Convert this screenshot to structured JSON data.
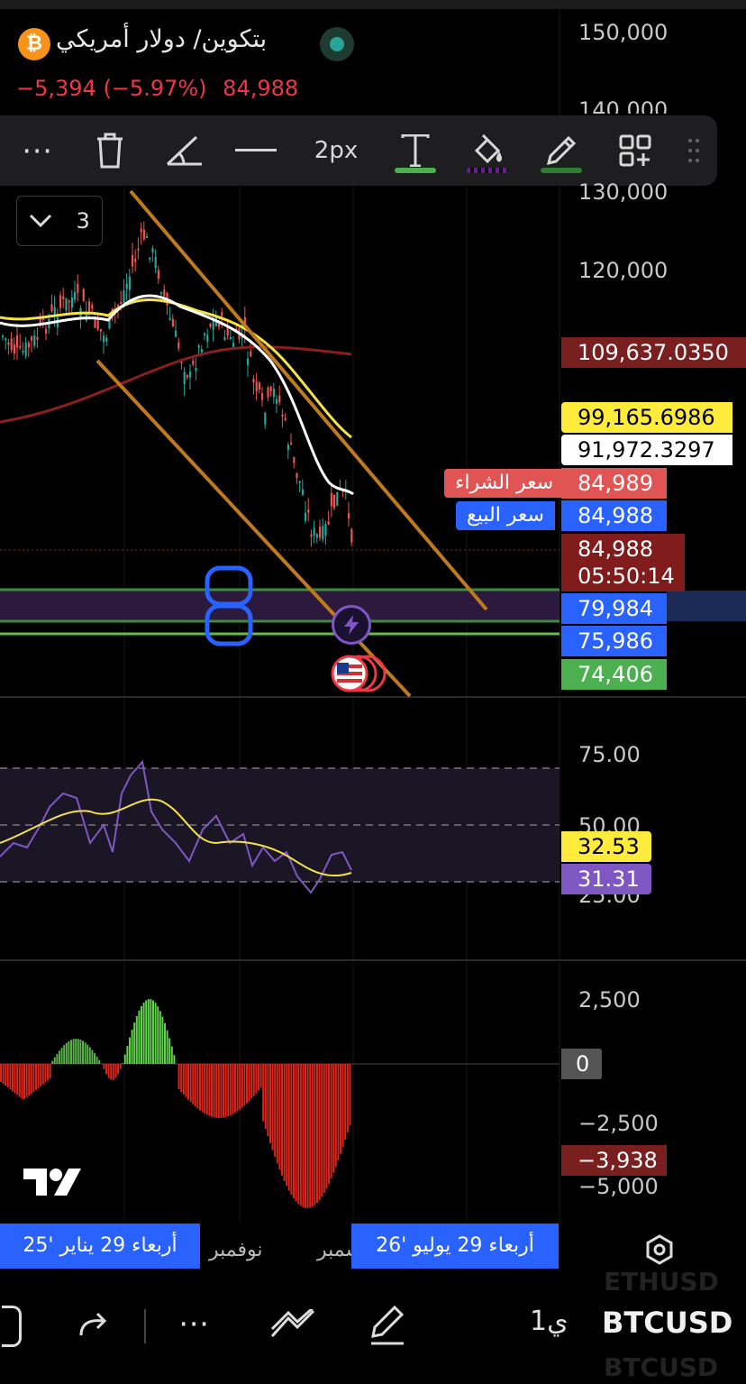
{
  "header": {
    "coin_icon": "bitcoin-icon",
    "symbol_title": "بتكوين/ دولار أمريكي",
    "change": "−5,394 (−5.97%)",
    "last_price": "84,988",
    "market_status": "live-dot"
  },
  "toolbar": {
    "more_label": "⋯",
    "delete_icon": "trash-icon",
    "angle_icon": "angle-icon",
    "line_style_icon": "line-style-icon",
    "width_label": "2px",
    "text_icon": "text-icon",
    "fill_icon": "fill-bucket-icon",
    "pencil_icon": "pencil-icon",
    "add_icon": "grid-plus-icon",
    "drag_icon": "drag-handle-icon",
    "text_color": "#4caf50",
    "fill_color": "#6a1b9a",
    "pencil_color": "#2e7d32"
  },
  "indicator_toggle": {
    "count": "3"
  },
  "price_axis": {
    "ticks": [
      "150,000",
      "140,000",
      "130,000",
      "120,000"
    ]
  },
  "price_tags": [
    {
      "value": "109,637.0350",
      "bg": "#7a1f1f",
      "fg": "#ffffff"
    },
    {
      "value": "99,165.6986",
      "bg": "#ffeb3b",
      "fg": "#000000"
    },
    {
      "value": "91,972.3297",
      "bg": "#ffffff",
      "fg": "#000000"
    },
    {
      "value": "84,989",
      "bg": "#e05454",
      "fg": "#ffffff"
    },
    {
      "value": "84,988",
      "bg": "#2962ff",
      "fg": "#ffffff"
    },
    {
      "value": "79,984",
      "bg": "#2962ff",
      "fg": "#ffffff"
    },
    {
      "value": "75,986",
      "bg": "#2962ff",
      "fg": "#ffffff"
    },
    {
      "value": "74,406",
      "bg": "#4caf50",
      "fg": "#ffffff"
    }
  ],
  "current_price": {
    "value": "84,988",
    "countdown": "05:50:14",
    "bg": "#801c1c"
  },
  "ask_label": "سعر الشراء",
  "bid_label": "سعر البيع",
  "rsi": {
    "ticks": [
      "75.00",
      "50.00",
      "25.00"
    ],
    "tags": [
      {
        "value": "32.53",
        "bg": "#ffeb3b",
        "fg": "#000000"
      },
      {
        "value": "31.31",
        "bg": "#7e57c2",
        "fg": "#ffffff"
      }
    ]
  },
  "macd": {
    "ticks": [
      "2,500",
      "−2,500",
      "−5,000"
    ],
    "zero_tag": "0",
    "value_tag": "−3,938"
  },
  "x_axis": {
    "left_pill": "أربعاء 29 يناير '25",
    "month_label": "نوفمبر",
    "partial_label": "سمبر",
    "right_pill": "أربعاء 29 يوليو '26",
    "settings_icon": "hexagon-settings-icon"
  },
  "bottom_bar": {
    "redo_icon": "redo-icon",
    "more_label": "⋯",
    "drawings_icon": "drawings-icon",
    "pen_icon": "pen-icon",
    "interval": "1ي",
    "symbol": "BTCUSD",
    "ghost_above": "ETHUSD",
    "ghost_below": "BTCUSD"
  },
  "annotations": {
    "number_eight": "8"
  },
  "brand": {
    "logo": "TV"
  }
}
